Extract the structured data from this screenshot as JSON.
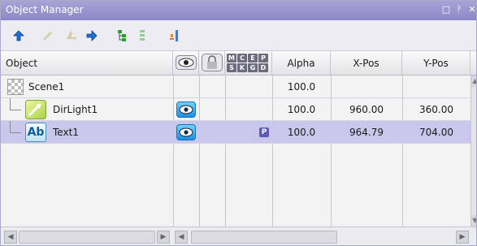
{
  "window": {
    "title": "Object Manager",
    "buttons": {
      "restore": "□",
      "pin": "ᚹ",
      "close": "✕"
    }
  },
  "toolbar": {
    "icons": [
      "arrow-up-icon",
      "edit-disabled-icon",
      "move-disabled-icon",
      "arrow-right-icon",
      "tree-expand-icon",
      "tree-collapse-icon",
      "sort-icon"
    ]
  },
  "columns": {
    "object": "Object",
    "alpha": "Alpha",
    "xpos": "X-Pos",
    "ypos": "Y-Pos",
    "flags_top": [
      "M",
      "C",
      "E",
      "P"
    ],
    "flags_bottom": [
      "S",
      "K",
      "G",
      "D"
    ]
  },
  "rows": [
    {
      "name": "Scene1",
      "alpha": "100.0",
      "xpos": "",
      "ypos": "",
      "icon": "scene-checker-icon",
      "visible": false,
      "badge": "",
      "selected": false
    },
    {
      "name": "DirLight1",
      "alpha": "100.0",
      "xpos": "960.00",
      "ypos": "360.00",
      "icon": "directional-light-icon",
      "visible": true,
      "badge": "",
      "selected": false
    },
    {
      "name": "Text1",
      "alpha": "100.0",
      "xpos": "964.79",
      "ypos": "704.00",
      "icon": "text-object-icon",
      "icon_text": "Ab",
      "visible": true,
      "badge": "P",
      "selected": true
    }
  ],
  "colors": {
    "titlebar": "#9b98d0",
    "selection": "#c9c7ec",
    "eye_blue": "#1e8fe0"
  }
}
